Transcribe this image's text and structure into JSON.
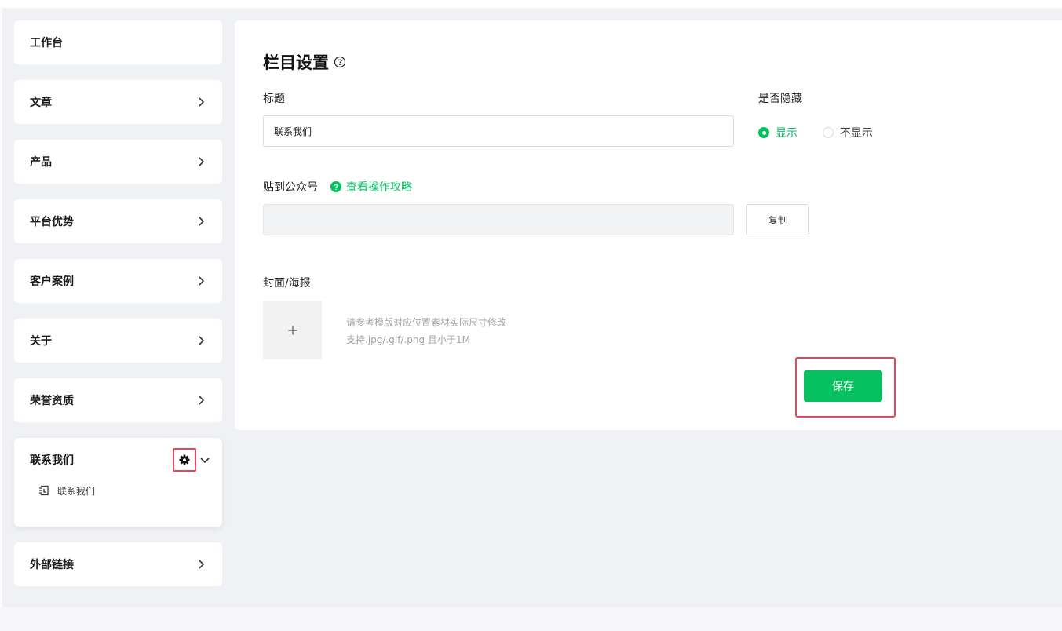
{
  "sidebar": {
    "items": [
      {
        "label": "工作台"
      },
      {
        "label": "文章"
      },
      {
        "label": "产品"
      },
      {
        "label": "平台优势"
      },
      {
        "label": "客户案例"
      },
      {
        "label": "关于"
      },
      {
        "label": "荣誉资质"
      },
      {
        "label": "联系我们",
        "sub_items": [
          {
            "label": "联系我们"
          }
        ]
      },
      {
        "label": "外部链接"
      }
    ]
  },
  "main": {
    "title": "栏目设置",
    "title_field": {
      "label": "标题",
      "value": "联系我们"
    },
    "visibility": {
      "label": "是否隐藏",
      "options": [
        "显示",
        "不显示"
      ],
      "selected": "显示"
    },
    "publish": {
      "label": "贴到公众号",
      "guide_link": "查看操作攻略",
      "value": "",
      "copy_button": "复制"
    },
    "cover": {
      "label": "封面/海报",
      "hint_line1": "请参考模版对应位置素材实际尺寸修改",
      "hint_line2": "支持.jpg/.gif/.png 且小于1M"
    },
    "save_button": "保存"
  },
  "colors": {
    "accent": "#07c160",
    "highlight": "#e8465a"
  }
}
